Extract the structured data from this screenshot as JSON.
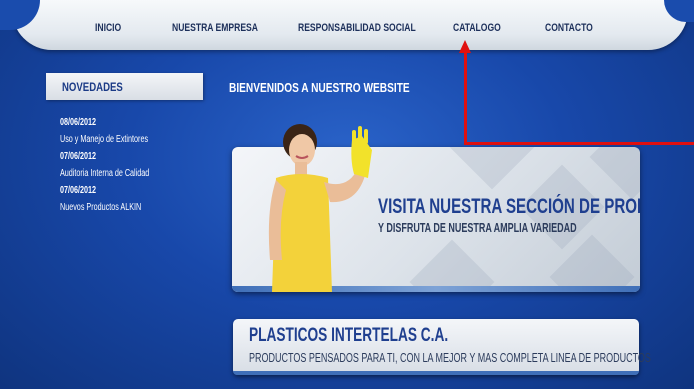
{
  "nav": {
    "items": [
      "INICIO",
      "NUESTRA EMPRESA",
      "RESPONSABILIDAD SOCIAL",
      "CATALOGO",
      "CONTACTO"
    ]
  },
  "novedades": {
    "title": "NOVEDADES",
    "entries": [
      {
        "date": "08/06/2012",
        "text": "Uso y Manejo de Extintores"
      },
      {
        "date": "07/06/2012",
        "text": "Auditoria Interna de Calidad"
      },
      {
        "date": "07/06/2012",
        "text": "Nuevos Productos ALKIN"
      }
    ]
  },
  "welcome": "BIENVENIDOS A NUESTRO WEBSITE",
  "banner": {
    "title": "VISITA NUESTRA SECCIÓN DE PRODUCTOS",
    "subtitle": "Y DISFRUTA DE NUESTRA AMPLIA VARIEDAD"
  },
  "company": {
    "name": "PLASTICOS INTERTELAS C.A.",
    "tagline": "PRODUCTOS PENSADOS PARA TI, CON LA MEJOR Y MAS COMPLETA LINEA DE PRODUCTOS"
  },
  "colors": {
    "background": "#1848aa",
    "nav_text": "#1c2f5a",
    "heading_blue": "#1f3f8f",
    "annotation": "#e01010",
    "glove": "#f2e22a",
    "dress": "#f3d23a"
  }
}
